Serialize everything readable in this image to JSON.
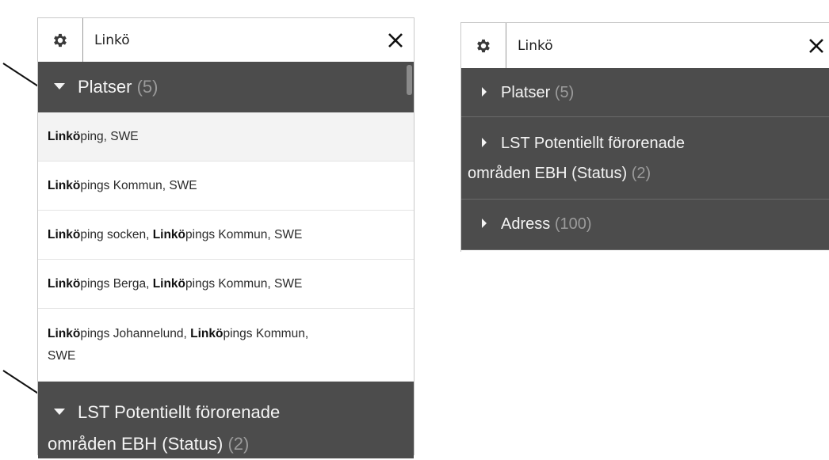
{
  "left_panel": {
    "search": {
      "value": "Linkö"
    },
    "groups": [
      {
        "label": "Platser",
        "count": "(5)",
        "expanded": true
      },
      {
        "label": "LST Potentiellt förorenade",
        "label_cont": "områden EBH (Status)",
        "count": "(2)",
        "expanded": true
      }
    ],
    "results": [
      {
        "bold": "Linkö",
        "rest": "ping, SWE"
      },
      {
        "bold": "Linkö",
        "rest": "pings Kommun, SWE"
      },
      {
        "bold": "Linkö",
        "rest": "ping socken, ",
        "bold2": "Linkö",
        "rest2": "pings Kommun, SWE"
      },
      {
        "bold": "Linkö",
        "rest": "pings Berga, ",
        "bold2": "Linkö",
        "rest2": "pings Kommun, SWE"
      },
      {
        "bold": "Linkö",
        "rest": "pings Johannelund, ",
        "bold2": "Linkö",
        "rest2": "pings Kommun,",
        "rest3": "SWE"
      }
    ]
  },
  "right_panel": {
    "search": {
      "value": "Linkö"
    },
    "groups": [
      {
        "label": "Platser",
        "count": "(5)",
        "expanded": false
      },
      {
        "label": "LST Potentiellt förorenade",
        "label_cont": "områden EBH (Status)",
        "count": "(2)",
        "expanded": false
      },
      {
        "label": "Adress",
        "count": "(100)",
        "expanded": false
      }
    ]
  },
  "icons": [
    "gear-icon",
    "close-icon",
    "caret-down-icon",
    "caret-right-icon",
    "annotation-arrow"
  ],
  "colors": {
    "header_bg": "#4c4c4c",
    "header_text": "#f4f4f4",
    "count_text": "#9b9b9b",
    "highlight_row": "#f3f3f3"
  }
}
